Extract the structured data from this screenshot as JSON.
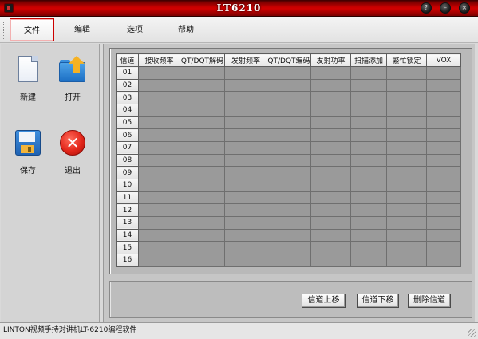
{
  "window": {
    "title": "LT6210",
    "controls": [
      "?",
      "–",
      "×"
    ]
  },
  "menu": {
    "items": [
      {
        "label": "文件",
        "active": true
      },
      {
        "label": "编辑",
        "active": false
      },
      {
        "label": "选项",
        "active": false
      },
      {
        "label": "帮助",
        "active": false
      }
    ]
  },
  "tools": [
    {
      "label": "新建",
      "icon": "new-document-icon"
    },
    {
      "label": "打开",
      "icon": "open-folder-icon"
    },
    {
      "label": "保存",
      "icon": "save-floppy-icon"
    },
    {
      "label": "退出",
      "icon": "exit-icon"
    }
  ],
  "grid": {
    "columns": [
      "信道",
      "接收频率",
      "QT/DQT解码",
      "发射频率",
      "QT/DQT编码",
      "发射功率",
      "扫描添加",
      "繁忙锁定",
      "VOX"
    ],
    "rows": [
      "01",
      "02",
      "03",
      "04",
      "05",
      "06",
      "07",
      "08",
      "09",
      "10",
      "11",
      "12",
      "13",
      "14",
      "15",
      "16"
    ]
  },
  "buttons": {
    "up": "信道上移",
    "down": "信道下移",
    "delete": "删除信道"
  },
  "status": {
    "text": "LINTON视频手持对讲机LT-6210编程软件"
  },
  "colors": {
    "titlebar": "#c80000",
    "active_menu_border": "#cc0000",
    "grid_cell": "#9a9a9a"
  }
}
